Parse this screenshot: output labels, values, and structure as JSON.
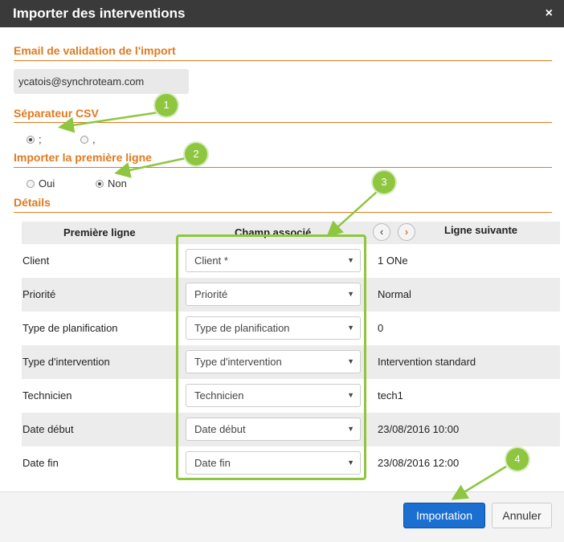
{
  "dialog": {
    "title": "Importer des interventions",
    "close_glyph": "×"
  },
  "email_section": {
    "heading": "Email de validation de l'import",
    "value": "ycatois@synchroteam.com"
  },
  "separator_section": {
    "heading": "Séparateur CSV",
    "options": [
      {
        "label": ";",
        "checked": true
      },
      {
        "label": ",",
        "checked": false
      }
    ]
  },
  "first_line_section": {
    "heading": "Importer la première ligne",
    "options": [
      {
        "label": "Oui",
        "checked": false
      },
      {
        "label": "Non",
        "checked": true
      }
    ]
  },
  "details_section": {
    "heading": "Détails",
    "columns": {
      "first_line": "Première ligne",
      "field": "Champ associé",
      "next_line": "Ligne suivante"
    },
    "pager": {
      "prev_glyph": "‹",
      "next_glyph": "›"
    },
    "rows": [
      {
        "label": "Client",
        "field": "Client *",
        "next": "1 ONe"
      },
      {
        "label": "Priorité",
        "field": "Priorité",
        "next": "Normal"
      },
      {
        "label": "Type de planification",
        "field": "Type de planification",
        "next": "0"
      },
      {
        "label": "Type d'intervention",
        "field": "Type d'intervention",
        "next": "Intervention standard"
      },
      {
        "label": "Technicien",
        "field": "Technicien",
        "next": "tech1"
      },
      {
        "label": "Date début",
        "field": "Date début",
        "next": "23/08/2016 10:00"
      },
      {
        "label": "Date fin",
        "field": "Date fin",
        "next": "23/08/2016 12:00"
      }
    ],
    "select_caret": "▼"
  },
  "footer": {
    "import_label": "Importation",
    "cancel_label": "Annuler"
  },
  "annotations": {
    "badges": [
      "1",
      "2",
      "3",
      "4"
    ],
    "color": "#8ec63f"
  },
  "colors": {
    "accent": "#e07a1f",
    "primary_button": "#1a6fd0",
    "titlebar": "#3a3a3a"
  }
}
